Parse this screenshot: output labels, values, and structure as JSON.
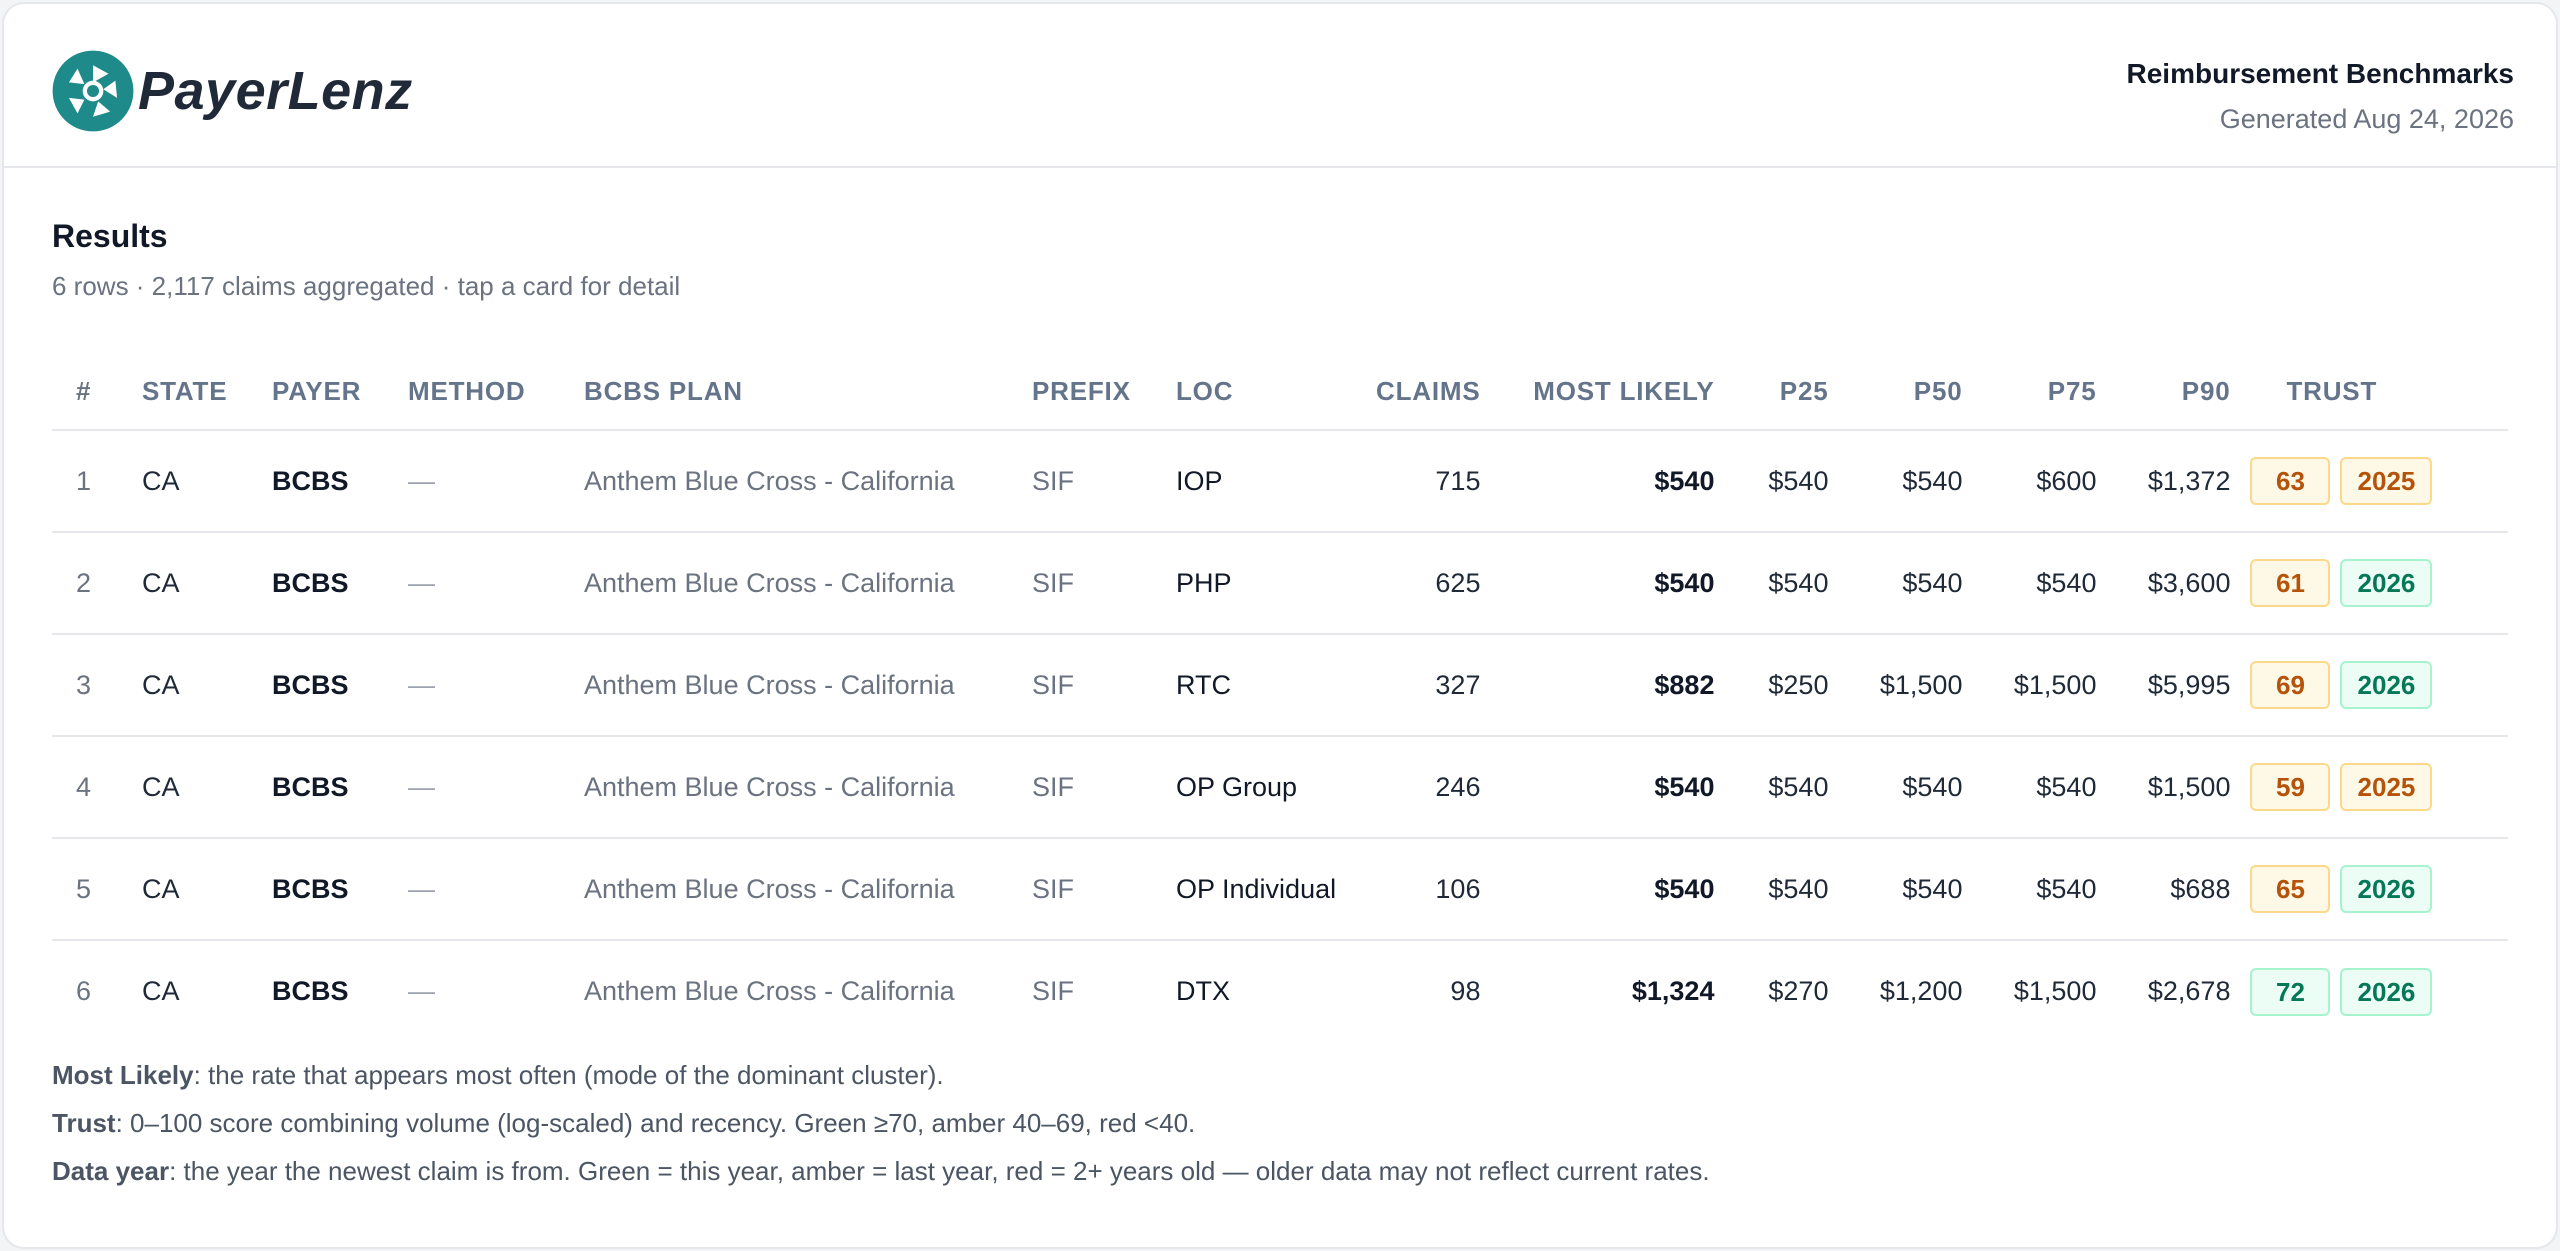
{
  "brand": {
    "name": "PayerLenz",
    "colors": {
      "accent": "#1e8a8a",
      "green": "#047857",
      "amber": "#b45309"
    }
  },
  "report": {
    "title": "Reimbursement Benchmarks",
    "generated": "Generated Aug 24, 2026"
  },
  "results": {
    "title": "Results",
    "subtitle": "6 rows · 2,117 claims aggregated · tap a card for detail"
  },
  "table": {
    "columns": [
      "#",
      "STATE",
      "PAYER",
      "METHOD",
      "BCBS PLAN",
      "PREFIX",
      "LOC",
      "CLAIMS",
      "MOST LIKELY",
      "P25",
      "P50",
      "P75",
      "P90",
      "TRUST"
    ],
    "rows": [
      {
        "idx": "1",
        "state": "CA",
        "payer": "BCBS",
        "method": "—",
        "plan": "Anthem Blue Cross - California",
        "prefix": "SIF",
        "loc": "IOP",
        "claims": "715",
        "most_likely": "$540",
        "p25": "$540",
        "p50": "$540",
        "p75": "$600",
        "p90": "$1,372",
        "trust": "63",
        "trust_level": "amber",
        "year": "2025",
        "year_level": "amber"
      },
      {
        "idx": "2",
        "state": "CA",
        "payer": "BCBS",
        "method": "—",
        "plan": "Anthem Blue Cross - California",
        "prefix": "SIF",
        "loc": "PHP",
        "claims": "625",
        "most_likely": "$540",
        "p25": "$540",
        "p50": "$540",
        "p75": "$540",
        "p90": "$3,600",
        "trust": "61",
        "trust_level": "amber",
        "year": "2026",
        "year_level": "green"
      },
      {
        "idx": "3",
        "state": "CA",
        "payer": "BCBS",
        "method": "—",
        "plan": "Anthem Blue Cross - California",
        "prefix": "SIF",
        "loc": "RTC",
        "claims": "327",
        "most_likely": "$882",
        "p25": "$250",
        "p50": "$1,500",
        "p75": "$1,500",
        "p90": "$5,995",
        "trust": "69",
        "trust_level": "amber",
        "year": "2026",
        "year_level": "green"
      },
      {
        "idx": "4",
        "state": "CA",
        "payer": "BCBS",
        "method": "—",
        "plan": "Anthem Blue Cross - California",
        "prefix": "SIF",
        "loc": "OP Group",
        "claims": "246",
        "most_likely": "$540",
        "p25": "$540",
        "p50": "$540",
        "p75": "$540",
        "p90": "$1,500",
        "trust": "59",
        "trust_level": "amber",
        "year": "2025",
        "year_level": "amber"
      },
      {
        "idx": "5",
        "state": "CA",
        "payer": "BCBS",
        "method": "—",
        "plan": "Anthem Blue Cross - California",
        "prefix": "SIF",
        "loc": "OP Individual",
        "claims": "106",
        "most_likely": "$540",
        "p25": "$540",
        "p50": "$540",
        "p75": "$540",
        "p90": "$688",
        "trust": "65",
        "trust_level": "amber",
        "year": "2026",
        "year_level": "green"
      },
      {
        "idx": "6",
        "state": "CA",
        "payer": "BCBS",
        "method": "—",
        "plan": "Anthem Blue Cross - California",
        "prefix": "SIF",
        "loc": "DTX",
        "claims": "98",
        "most_likely": "$1,324",
        "p25": "$270",
        "p50": "$1,200",
        "p75": "$1,500",
        "p90": "$2,678",
        "trust": "72",
        "trust_level": "green",
        "year": "2026",
        "year_level": "green"
      }
    ]
  },
  "notes": [
    {
      "term": "Most Likely",
      "text": ": the rate that appears most often (mode of the dominant cluster)."
    },
    {
      "term": "Trust",
      "text": ": 0–100 score combining volume (log-scaled) and recency. Green ≥70, amber 40–69, red <40."
    },
    {
      "term": "Data year",
      "text": ": the year the newest claim is from. Green = this year, amber = last year, red = 2+ years old — older data may not reflect current rates."
    }
  ]
}
